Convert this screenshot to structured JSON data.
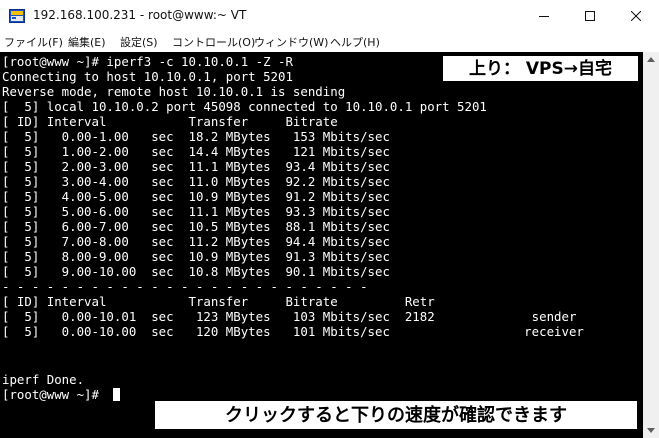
{
  "window": {
    "title": "192.168.100.231 - root@www:~ VT"
  },
  "menu": {
    "items": [
      "ファイル(F)",
      "編集(E)",
      "設定(S)",
      "コントロール(O)",
      "ウィンドウ(W)",
      "ヘルプ(H)"
    ]
  },
  "terminal": {
    "lines": [
      "[root@www ~]# iperf3 -c 10.10.0.1 -Z -R",
      "Connecting to host 10.10.0.1, port 5201",
      "Reverse mode, remote host 10.10.0.1 is sending",
      "[  5] local 10.10.0.2 port 45098 connected to 10.10.0.1 port 5201",
      "[ ID] Interval           Transfer     Bitrate",
      "[  5]   0.00-1.00   sec  18.2 MBytes   153 Mbits/sec",
      "[  5]   1.00-2.00   sec  14.4 MBytes   121 Mbits/sec",
      "[  5]   2.00-3.00   sec  11.1 MBytes  93.4 Mbits/sec",
      "[  5]   3.00-4.00   sec  11.0 MBytes  92.2 Mbits/sec",
      "[  5]   4.00-5.00   sec  10.9 MBytes  91.2 Mbits/sec",
      "[  5]   5.00-6.00   sec  11.1 MBytes  93.3 Mbits/sec",
      "[  5]   6.00-7.00   sec  10.5 MBytes  88.1 Mbits/sec",
      "[  5]   7.00-8.00   sec  11.2 MBytes  94.4 Mbits/sec",
      "[  5]   8.00-9.00   sec  10.9 MBytes  91.3 Mbits/sec",
      "[  5]   9.00-10.00  sec  10.8 MBytes  90.1 Mbits/sec",
      "- - - - - - - - - - - - - - - - - - - - - - - - -",
      "[ ID] Interval           Transfer     Bitrate         Retr",
      "[  5]   0.00-10.01  sec   123 MBytes   103 Mbits/sec  2182             sender",
      "[  5]   0.00-10.00  sec   120 MBytes   101 Mbits/sec                  receiver",
      "",
      "iperf Done.",
      "[root@www ~]# "
    ]
  },
  "overlays": {
    "top_label": "上り： VPS→自宅",
    "bottom_label": "クリックすると下りの速度が確認できます"
  },
  "colors": {
    "terminal_bg": "#000000",
    "terminal_fg": "#ffffff"
  }
}
